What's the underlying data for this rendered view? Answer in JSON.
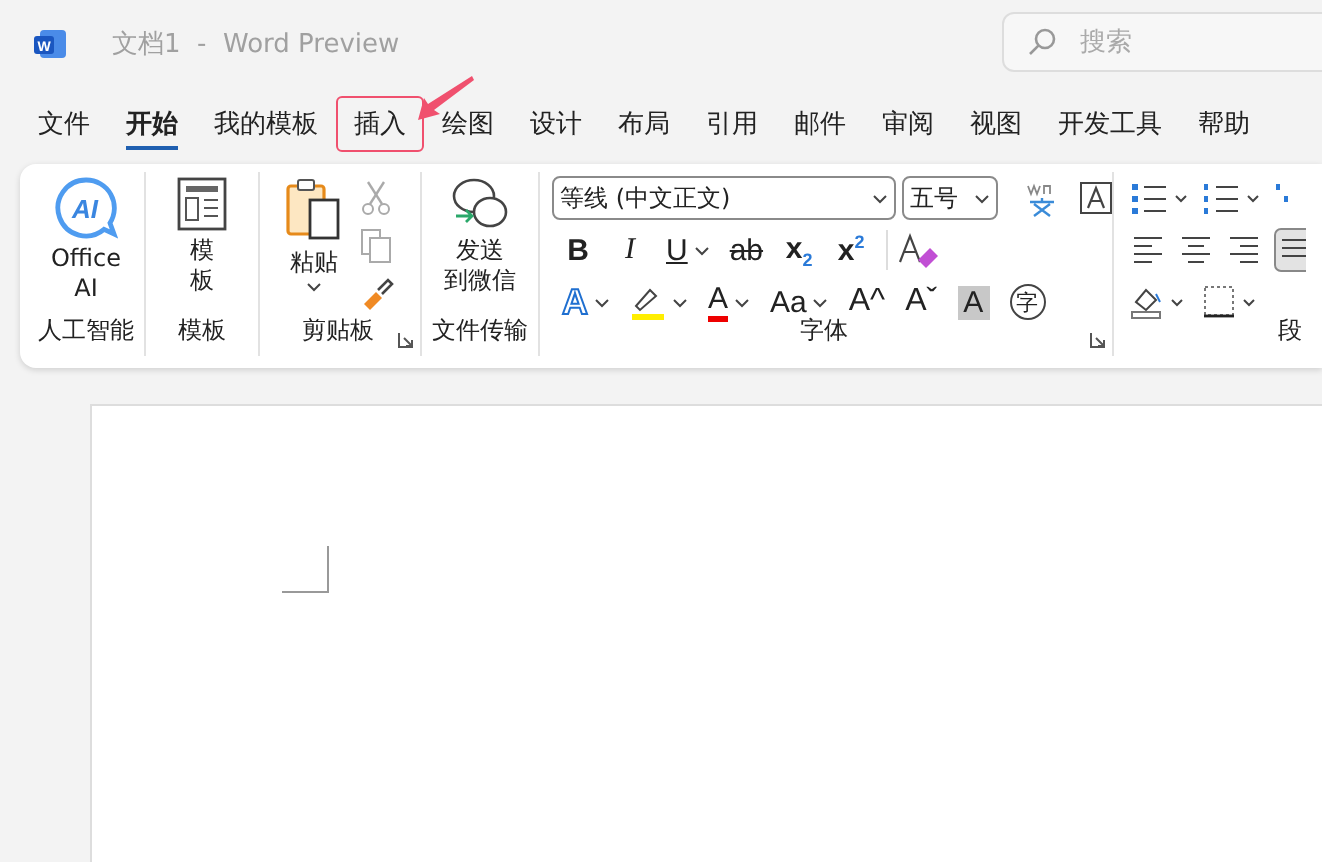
{
  "window": {
    "title": "文档1  -  Word Preview"
  },
  "search": {
    "placeholder": "搜索"
  },
  "tabs": [
    {
      "label": "文件",
      "selected": false,
      "highlighted": false
    },
    {
      "label": "开始",
      "selected": true,
      "highlighted": false
    },
    {
      "label": "我的模板",
      "selected": false,
      "highlighted": false
    },
    {
      "label": "插入",
      "selected": false,
      "highlighted": true
    },
    {
      "label": "绘图",
      "selected": false,
      "highlighted": false
    },
    {
      "label": "设计",
      "selected": false,
      "highlighted": false
    },
    {
      "label": "布局",
      "selected": false,
      "highlighted": false
    },
    {
      "label": "引用",
      "selected": false,
      "highlighted": false
    },
    {
      "label": "邮件",
      "selected": false,
      "highlighted": false
    },
    {
      "label": "审阅",
      "selected": false,
      "highlighted": false
    },
    {
      "label": "视图",
      "selected": false,
      "highlighted": false
    },
    {
      "label": "开发工具",
      "selected": false,
      "highlighted": false
    },
    {
      "label": "帮助",
      "selected": false,
      "highlighted": false
    }
  ],
  "ribbon": {
    "logo": {
      "letter": "W"
    },
    "ai": {
      "icon_text": "AI",
      "button": "Office\nAI",
      "group": "人工智能"
    },
    "template": {
      "button": [
        "模",
        "板"
      ],
      "group": "模板"
    },
    "clipboard": {
      "paste": "粘贴",
      "group": "剪贴板"
    },
    "transfer": {
      "button": [
        "发送",
        "到微信"
      ],
      "group": "文件传输"
    },
    "font": {
      "name": "等线 (中文正文)",
      "size": "五号",
      "group": "字体",
      "row1": [
        {
          "kind": "bold",
          "label": "B"
        },
        {
          "kind": "italic",
          "label": "I"
        },
        {
          "kind": "underline",
          "label": "U"
        },
        {
          "kind": "strike",
          "label": "ab"
        },
        {
          "kind": "sub",
          "label": "x$_{2}$"
        },
        {
          "kind": "sup",
          "label": "x$^{2}$"
        }
      ],
      "row2": [
        {
          "kind": "effect",
          "label": "A"
        },
        {
          "kind": "highlight"
        },
        {
          "kind": "color",
          "label": "A"
        },
        {
          "kind": "case",
          "label": "Aa"
        },
        {
          "kind": "grow",
          "label": "A^"
        },
        {
          "kind": "shrink",
          "label": "Aˇ"
        },
        {
          "kind": "shade",
          "label": "A"
        },
        {
          "kind": "enclose",
          "label": "字"
        }
      ]
    },
    "paragraph": {
      "group": "段"
    }
  }
}
